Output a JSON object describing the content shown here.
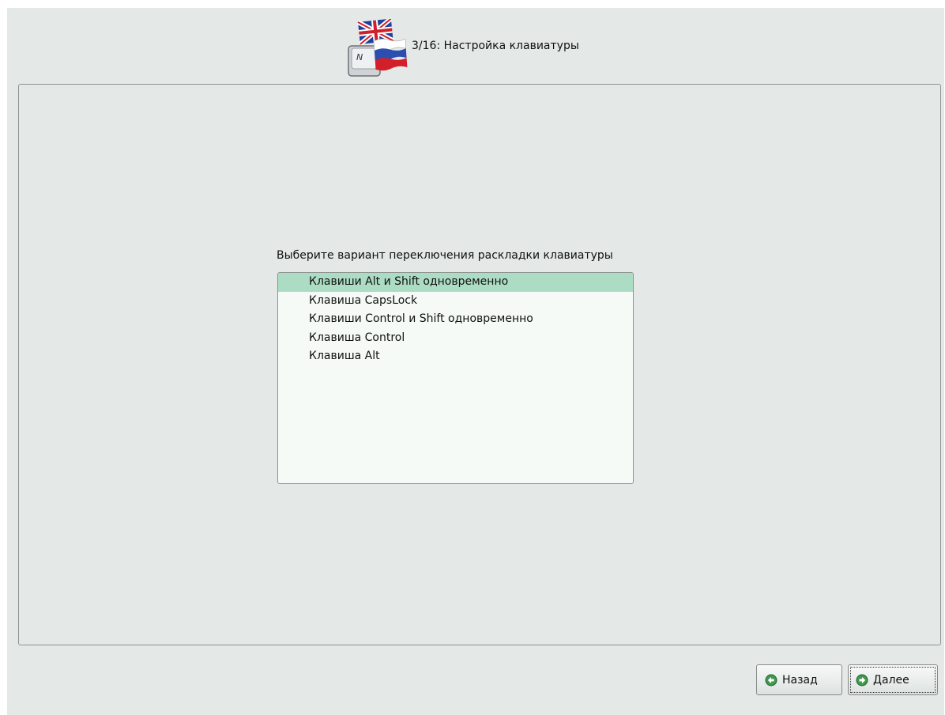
{
  "header": {
    "title": "3/16: Настройка клавиатуры",
    "icon": "keyboard-layout-flags-icon",
    "key_letter": "N"
  },
  "main": {
    "prompt": "Выберите вариант переключения раскладки клавиатуры",
    "options": [
      {
        "label": "Клавиши Alt и Shift одновременно",
        "selected": true
      },
      {
        "label": "Клавиша CapsLock",
        "selected": false
      },
      {
        "label": "Клавиши Control и Shift одновременно",
        "selected": false
      },
      {
        "label": "Клавиша Control",
        "selected": false
      },
      {
        "label": "Клавиша Alt",
        "selected": false
      }
    ]
  },
  "footer": {
    "back_label": "Назад",
    "next_label": "Далее",
    "back_icon": "arrow-left-circle-icon",
    "next_icon": "arrow-right-circle-icon"
  },
  "colors": {
    "background": "#e4e8e7",
    "selection": "#acdcc3",
    "list_background": "#f5faf6",
    "icon_green": "#2e8b3e"
  }
}
